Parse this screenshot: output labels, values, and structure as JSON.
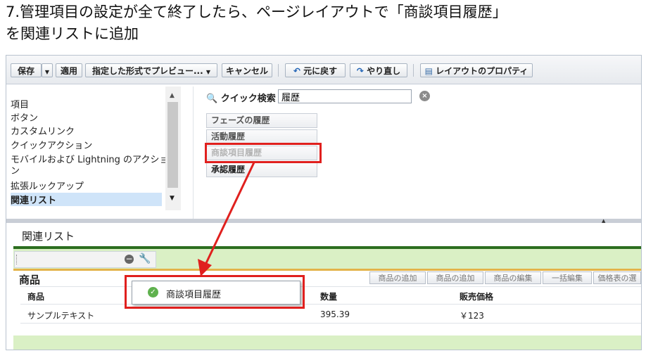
{
  "caption": {
    "line1": "7.管理項目の設定が全て終了したら、ページレイアウトで「商談項目履歴」",
    "line2": "を関連リストに追加"
  },
  "toolbar": {
    "save": "保存",
    "apply": "適用",
    "preview": "指定した形式でプレビュー...",
    "cancel": "キャンセル",
    "undo": "元に戻す",
    "redo": "やり直し",
    "layout_props": "レイアウトのプロパティ"
  },
  "palette": {
    "items": [
      "項目",
      "ボタン",
      "カスタムリンク",
      "クイックアクション",
      "モバイルおよび Lightning のアクショ",
      "ン",
      "拡張ルックアップ",
      "関連リスト"
    ],
    "selected": "関連リスト"
  },
  "quick_search": {
    "label": "クイック検索",
    "value": "履歴"
  },
  "results": [
    "フェーズの履歴",
    "活動履歴",
    "商談項目履歴",
    "承認履歴"
  ],
  "related_list": {
    "title": "関連リスト",
    "section": "商品",
    "buttons": [
      "商品の追加",
      "商品の追加",
      "商品の編集",
      "一括編集",
      "価格表の選"
    ],
    "columns": [
      "商品",
      "数量",
      "販売価格"
    ],
    "row": [
      "サンプルテキスト",
      "395.39",
      "￥123"
    ]
  },
  "drag_item": "商談項目履歴",
  "colors": {
    "highlight": "#e0201e",
    "accent_green": "#2c6e1f",
    "selected_bg": "#cfe4f9"
  }
}
